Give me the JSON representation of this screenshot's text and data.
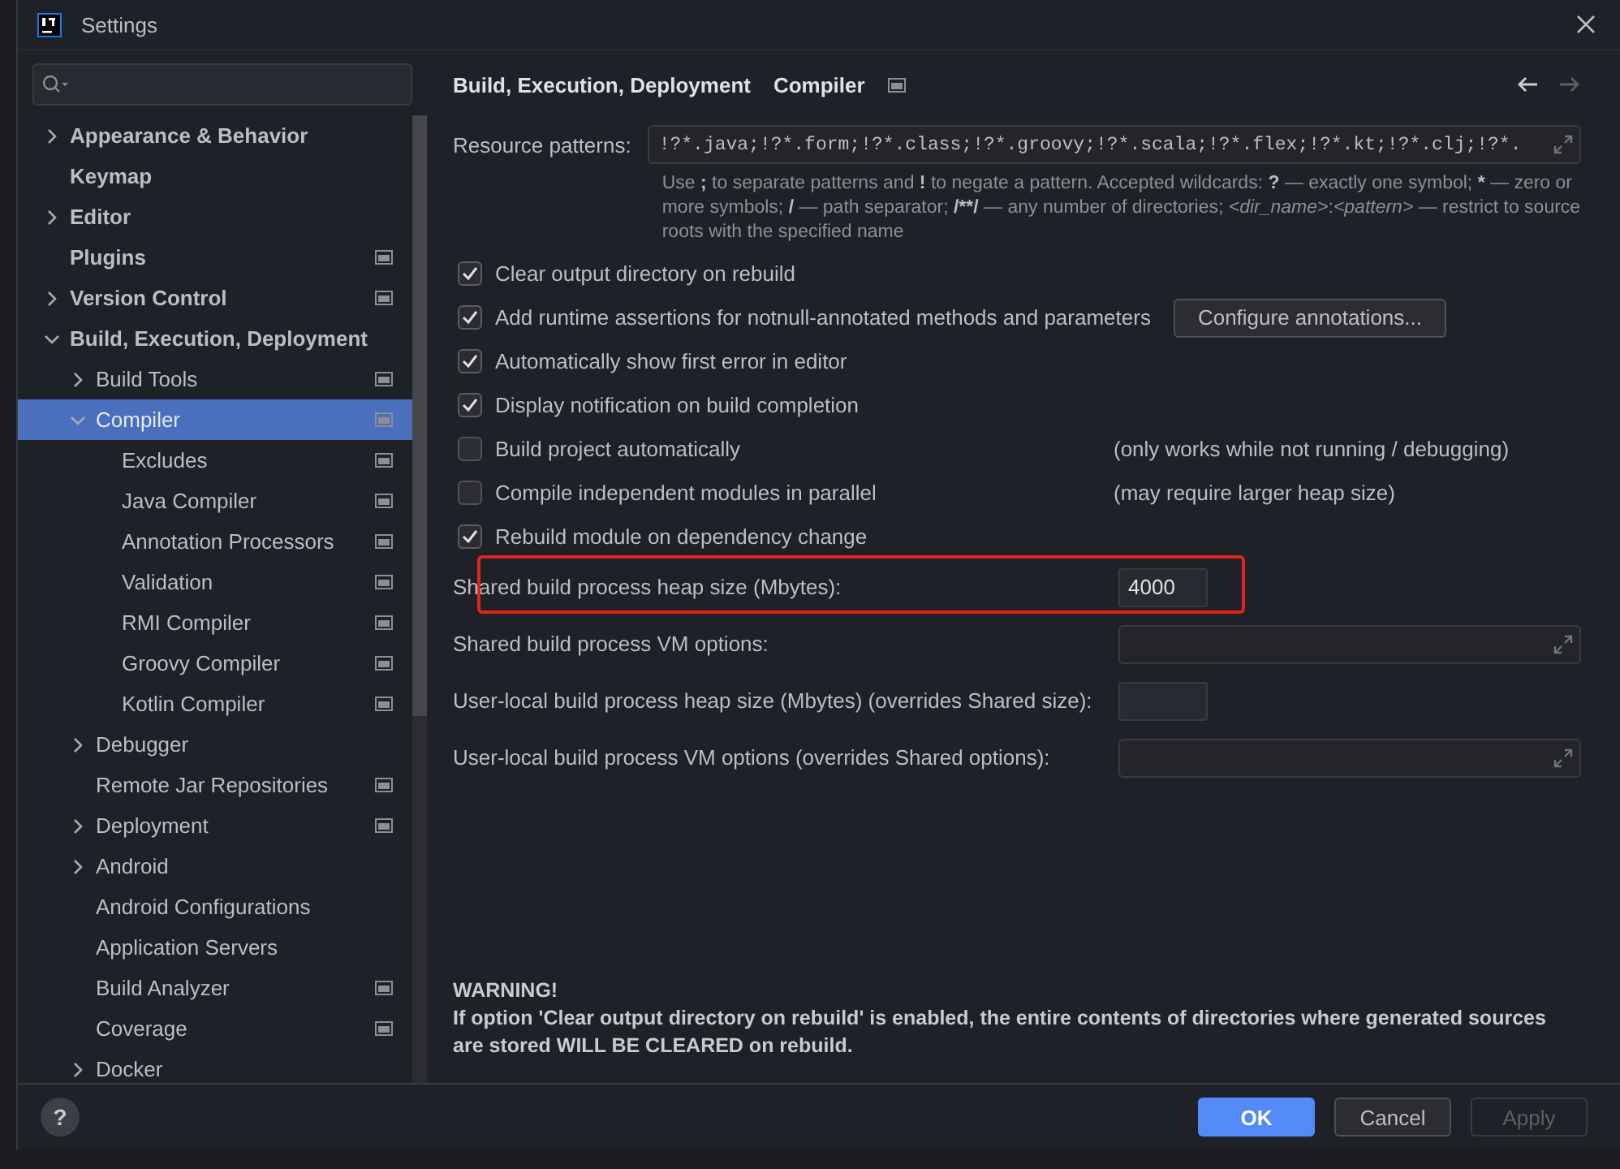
{
  "window": {
    "title": "Settings"
  },
  "sidebar": {
    "tree": [
      {
        "label": "Appearance & Behavior",
        "expanded": false,
        "selected": false,
        "project_icon": false
      },
      {
        "label": "Keymap",
        "selected": false,
        "project_icon": false
      },
      {
        "label": "Editor",
        "expanded": false,
        "selected": false,
        "project_icon": false
      },
      {
        "label": "Plugins",
        "selected": false,
        "project_icon": true
      },
      {
        "label": "Version Control",
        "expanded": false,
        "selected": false,
        "project_icon": true
      },
      {
        "label": "Build, Execution, Deployment",
        "expanded": true,
        "selected": false,
        "project_icon": false,
        "children": [
          {
            "label": "Build Tools",
            "expanded": false,
            "selected": false,
            "project_icon": true
          },
          {
            "label": "Compiler",
            "expanded": true,
            "selected": true,
            "project_icon": true,
            "children": [
              {
                "label": "Excludes",
                "selected": false,
                "project_icon": true
              },
              {
                "label": "Java Compiler",
                "selected": false,
                "project_icon": true
              },
              {
                "label": "Annotation Processors",
                "selected": false,
                "project_icon": true
              },
              {
                "label": "Validation",
                "selected": false,
                "project_icon": true
              },
              {
                "label": "RMI Compiler",
                "selected": false,
                "project_icon": true
              },
              {
                "label": "Groovy Compiler",
                "selected": false,
                "project_icon": true
              },
              {
                "label": "Kotlin Compiler",
                "selected": false,
                "project_icon": true
              }
            ]
          },
          {
            "label": "Debugger",
            "expanded": false,
            "selected": false,
            "project_icon": false
          },
          {
            "label": "Remote Jar Repositories",
            "selected": false,
            "project_icon": true
          },
          {
            "label": "Deployment",
            "expanded": false,
            "selected": false,
            "project_icon": true
          },
          {
            "label": "Android",
            "expanded": false,
            "selected": false,
            "project_icon": false
          },
          {
            "label": "Android Configurations",
            "selected": false,
            "project_icon": false
          },
          {
            "label": "Application Servers",
            "selected": false,
            "project_icon": false
          },
          {
            "label": "Build Analyzer",
            "selected": false,
            "project_icon": true
          },
          {
            "label": "Coverage",
            "selected": false,
            "project_icon": true
          },
          {
            "label": "Docker",
            "expanded": false,
            "selected": false,
            "project_icon": false
          }
        ]
      }
    ]
  },
  "breadcrumb": {
    "items": [
      "Build, Execution, Deployment",
      "Compiler"
    ],
    "project_icon": true,
    "back_enabled": true,
    "forward_enabled": false
  },
  "resource_patterns": {
    "label": "Resource patterns:",
    "value": "!?*.java;!?*.form;!?*.class;!?*.groovy;!?*.scala;!?*.flex;!?*.kt;!?*.clj;!?*.",
    "hint": [
      {
        "text": "Use ",
        "kind": "plain"
      },
      {
        "text": ";",
        "kind": "bold"
      },
      {
        "text": " to separate patterns and ",
        "kind": "plain"
      },
      {
        "text": "!",
        "kind": "bold"
      },
      {
        "text": " to negate a pattern. Accepted wildcards: ",
        "kind": "plain"
      },
      {
        "text": "?",
        "kind": "bold"
      },
      {
        "text": " — exactly one symbol; ",
        "kind": "plain"
      },
      {
        "text": "*",
        "kind": "bold"
      },
      {
        "text": " — zero or more symbols; ",
        "kind": "plain"
      },
      {
        "text": "/",
        "kind": "bold"
      },
      {
        "text": " — path separator; ",
        "kind": "plain"
      },
      {
        "text": "/**/",
        "kind": "bold"
      },
      {
        "text": " — any number of directories; ",
        "kind": "plain"
      },
      {
        "text": "<dir_name>",
        "kind": "italic"
      },
      {
        "text": ":",
        "kind": "plain"
      },
      {
        "text": "<pattern>",
        "kind": "italic"
      },
      {
        "text": " — restrict to source roots with the specified name",
        "kind": "plain"
      }
    ]
  },
  "options": [
    {
      "label": "Clear output directory on rebuild",
      "checked": true
    },
    {
      "label": "Add runtime assertions for notnull-annotated methods and parameters",
      "checked": true,
      "button": "Configure annotations..."
    },
    {
      "label": "Automatically show first error in editor",
      "checked": true
    },
    {
      "label": "Display notification on build completion",
      "checked": true
    },
    {
      "label": "Build project automatically",
      "checked": false,
      "note": "(only works while not running / debugging)"
    },
    {
      "label": "Compile independent modules in parallel",
      "checked": false,
      "note": "(may require larger heap size)"
    },
    {
      "label": "Rebuild module on dependency change",
      "checked": true
    }
  ],
  "fields": [
    {
      "label": "Shared build process heap size (Mbytes):",
      "kind": "number",
      "value": "4000",
      "highlighted": true
    },
    {
      "label": "Shared build process VM options:",
      "kind": "options",
      "highlighted": false
    },
    {
      "label": "User-local build process heap size (Mbytes) (overrides Shared size):",
      "kind": "number",
      "highlighted": false
    },
    {
      "label": "User-local build process VM options (overrides Shared options):",
      "kind": "options",
      "highlighted": false
    }
  ],
  "warning": {
    "title": "WARNING!",
    "text": "If option 'Clear output directory on rebuild' is enabled, the entire contents of directories where generated sources are stored WILL BE CLEARED on rebuild."
  },
  "footer": {
    "help": "?",
    "buttons": [
      {
        "label": "OK",
        "kind": "primary",
        "disabled": false
      },
      {
        "label": "Cancel",
        "kind": "default",
        "disabled": false
      },
      {
        "label": "Apply",
        "kind": "default",
        "disabled": true
      }
    ]
  }
}
